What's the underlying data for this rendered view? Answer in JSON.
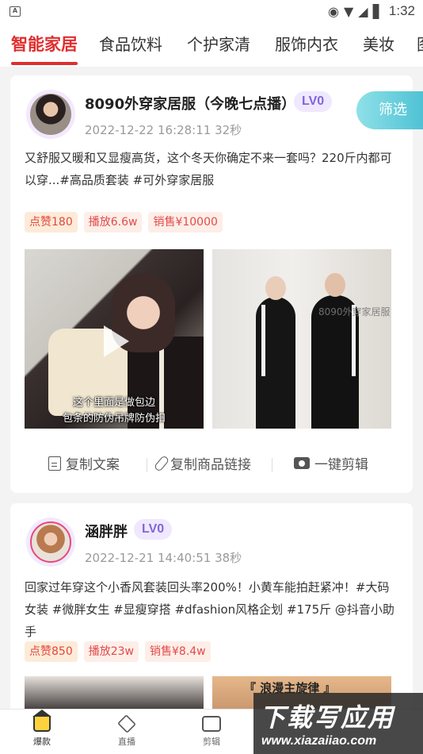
{
  "status_bar": {
    "app_badge": "A",
    "time": "1:32"
  },
  "tabs": [
    "智能家居",
    "食品饮料",
    "个护家清",
    "服饰内衣",
    "美妆",
    "图"
  ],
  "filter_label": "筛选",
  "posts": [
    {
      "shop_name": "8090外穿家居服（今晚七点播）",
      "level": "LV0",
      "time": "2022-12-22 16:28:11 32秒",
      "description": "又舒服又暖和又显瘦高货，这个冬天你确定不来一套吗？220斤内都可以穿...#高品质套装 #可外穿家居服",
      "tags": {
        "likes": "点赞180",
        "plays": "播放6.6w",
        "sales": "销售¥10000"
      },
      "media_caption_line1": "这个里面是做包边",
      "media_caption_line2": "包条的防伪吊牌防伪扣",
      "media2_watermark": "8090外穿家居服",
      "actions": {
        "copy_text": "复制文案",
        "copy_link": "复制商品链接",
        "one_click_edit": "一键剪辑"
      }
    },
    {
      "shop_name": "涵胖胖",
      "level": "LV0",
      "time": "2022-12-21 14:40:51 38秒",
      "description": "回家过年穿这个小香风套装回头率200%！小黄车能拍赶紧冲！#大码女装 #微胖女生 #显瘦穿搭 #dfashion风格企划 #175斤 @抖音小助手",
      "tags": {
        "likes": "点赞850",
        "plays": "播放23w",
        "sales": "销售¥8.4w"
      },
      "media2_title": "『 浪漫主旋律 』"
    }
  ],
  "bottom_nav": [
    "爆款",
    "直播",
    "剪辑"
  ],
  "site_watermark": {
    "big": "下载写应用",
    "small": "www.xiazaiiao.com"
  }
}
